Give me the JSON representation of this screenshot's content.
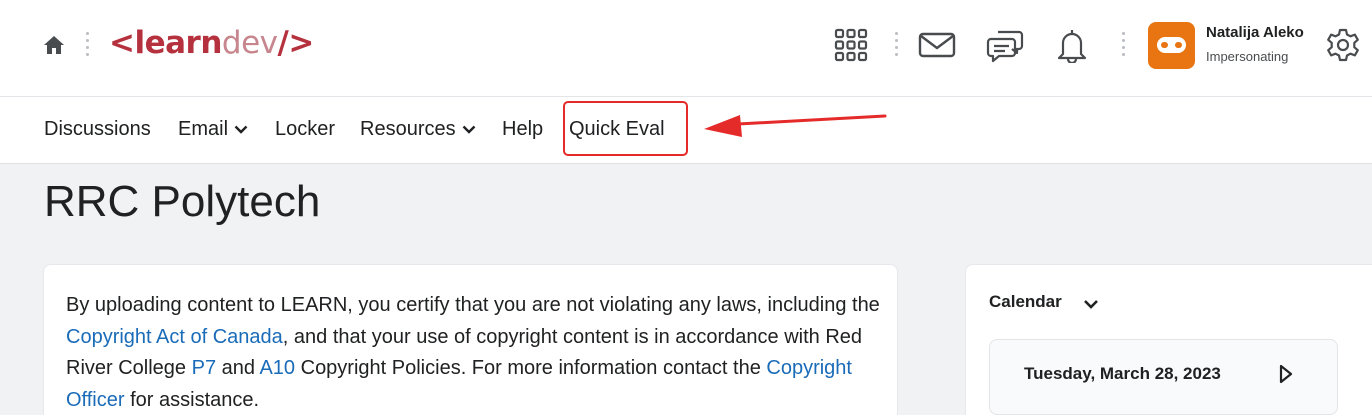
{
  "header": {
    "logo": {
      "lt": "<",
      "learn": "learn",
      "dev": "dev",
      "gt": "/>"
    },
    "icons": [
      "home-icon",
      "grid-icon",
      "mail-icon",
      "chat-icon",
      "bell-icon",
      "gear-icon"
    ],
    "user": {
      "name": "Natalija Aleko",
      "role": "Impersonating"
    },
    "accent": "#b4313d",
    "avatar_color": "#e87511"
  },
  "nav": {
    "items": [
      {
        "label": "Discussions"
      },
      {
        "label": "Email"
      },
      {
        "label": "Locker"
      },
      {
        "label": "Resources"
      },
      {
        "label": "Help"
      },
      {
        "label": "Quick Eval"
      }
    ],
    "highlight_color": "#e52a2a"
  },
  "main": {
    "title": "RRC Polytech",
    "notice": {
      "t1": "By uploading content to LEARN, you certify that you are not violating any laws, including the ",
      "link1": "Copyright Act of Canada",
      "t2": ", and that your use of copyright content is in accordance with Red River College ",
      "link2": "P7",
      "t3": " and ",
      "link3": "A10",
      "t4": " Copyright Policies. For more information contact the ",
      "link4": "Copyright Officer",
      "t5": " for assistance."
    },
    "link_color": "#1a6bb8"
  },
  "calendar": {
    "title": "Calendar",
    "date": "Tuesday, March 28, 2023"
  }
}
